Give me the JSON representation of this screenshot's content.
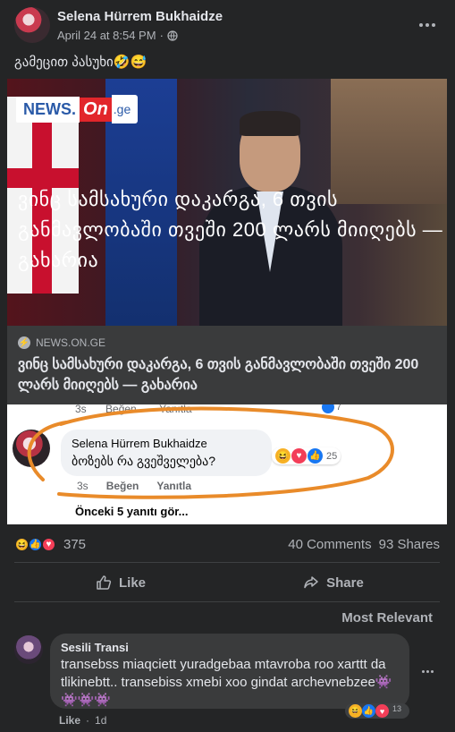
{
  "post": {
    "author": "Selena Hürrem Bukhaidze",
    "date": "April 24 at 8:54 PM",
    "separator": "·",
    "text": "გამეცით პასუხი🤣😅"
  },
  "news_image": {
    "logo_news": "NEWS.",
    "logo_on": "On",
    "logo_ge": ".ge",
    "overlay_title": "ვინც სამსახური დაკარგა, 6 თვის განმავლობაში თვეში 200 ლარს მიიღებს — გახარია"
  },
  "link_preview": {
    "domain": "NEWS.ON.GE",
    "title": "ვინც სამსახური დაკარგა, 6 თვის განმავლობაში თვეში 200 ლარს მიიღებს — გახარია"
  },
  "embedded_comment": {
    "top_time": "3s",
    "top_like": "Beğen",
    "top_reply": "Yanıtla",
    "top_count": "7",
    "name": "Selena Hürrem Bukhaidze",
    "text": "ბოზებს რა გვეშველება?",
    "react_count": "25",
    "time": "3s",
    "like": "Beğen",
    "reply": "Yanıtla",
    "more_replies": "Önceki 5 yanıtı gör..."
  },
  "reactions_summary": {
    "count": "375",
    "comments": "40 Comments",
    "shares": "93 Shares"
  },
  "actions": {
    "like": "Like",
    "share": "Share"
  },
  "sort": {
    "label": "Most Relevant"
  },
  "comment": {
    "author": "Sesili Transi",
    "text": "transebss miaqciett yuradgebaa mtavroba roo xarttt da tlikinebtt.. transebiss xmebi xoo gindat archevnebzee👾👾👾👾",
    "react_count": "13",
    "like": "Like",
    "time_sep": "·",
    "time": "1d"
  },
  "colors": {
    "background": "#242526",
    "text": "#e4e6eb",
    "muted": "#b0b3b8",
    "accent_orange": "#e98b2a",
    "news_red": "#e2262b"
  },
  "icons": [
    "globe-icon",
    "more-icon",
    "bolt-icon",
    "like-icon",
    "share-icon",
    "haha-icon",
    "love-icon"
  ]
}
